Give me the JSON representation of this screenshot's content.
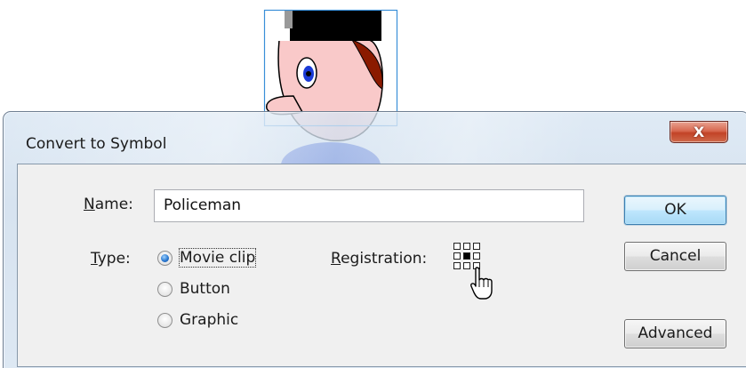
{
  "dialog": {
    "title": "Convert to Symbol",
    "close_label": "X"
  },
  "form": {
    "name_label_prefix": "",
    "name_label_underlined": "N",
    "name_label_rest": "ame:",
    "name_value": "Policeman",
    "type_label_underlined": "T",
    "type_label_rest": "ype:",
    "type_options": [
      {
        "label": "Movie clip",
        "checked": true
      },
      {
        "label": "Button",
        "checked": false
      },
      {
        "label": "Graphic",
        "checked": false
      }
    ],
    "registration_label_underlined": "R",
    "registration_label_rest": "egistration:",
    "registration_selected": "center"
  },
  "buttons": {
    "ok": "OK",
    "cancel": "Cancel",
    "advanced": "Advanced"
  },
  "colors": {
    "hat": "#000000",
    "hat_band": "#999999",
    "face": "#f9c9c9",
    "hair": "#8b1a00",
    "eye_iris": "#1a3ad6",
    "uniform": "#2d4fd6",
    "selection": "#3a8fd8"
  }
}
